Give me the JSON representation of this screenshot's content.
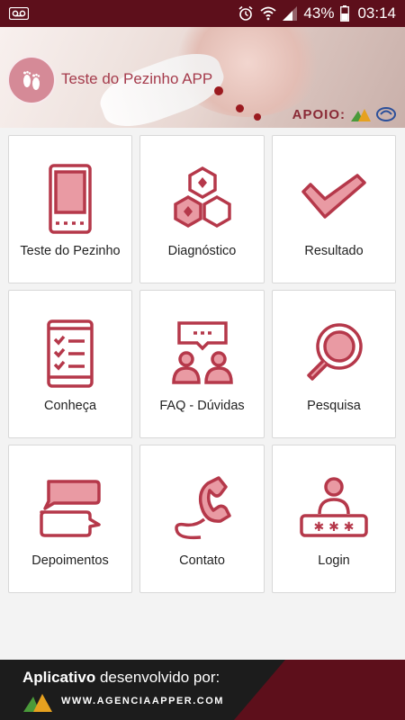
{
  "status_bar": {
    "battery": "43%",
    "time": "03:14",
    "icons": [
      "voicemail-icon",
      "alarm-icon",
      "wifi-icon",
      "signal-icon",
      "battery-icon"
    ]
  },
  "header": {
    "title": "Teste do Pezinho APP",
    "apoio_label": "APOIO:"
  },
  "menu": {
    "items": [
      {
        "label": "Teste do Pezinho",
        "icon": "tablet-icon"
      },
      {
        "label": "Diagnóstico",
        "icon": "molecule-icon"
      },
      {
        "label": "Resultado",
        "icon": "checkmark-icon"
      },
      {
        "label": "Conheça",
        "icon": "checklist-icon"
      },
      {
        "label": "FAQ - Dúvidas",
        "icon": "discussion-icon"
      },
      {
        "label": "Pesquisa",
        "icon": "magnifier-icon"
      },
      {
        "label": "Depoimentos",
        "icon": "chat-bubbles-icon"
      },
      {
        "label": "Contato",
        "icon": "phone-icon"
      },
      {
        "label": "Login",
        "icon": "user-password-icon"
      }
    ]
  },
  "footer": {
    "text_bold": "Aplicativo",
    "text_rest": " desenvolvido por:",
    "url": "WWW.AGENCIAAPPER.COM"
  },
  "colors": {
    "accent": "#b5384a",
    "status_bar": "#5d0f1b",
    "footer_dark": "#1c1c1c",
    "footer_wedge": "#5d0f1b"
  }
}
